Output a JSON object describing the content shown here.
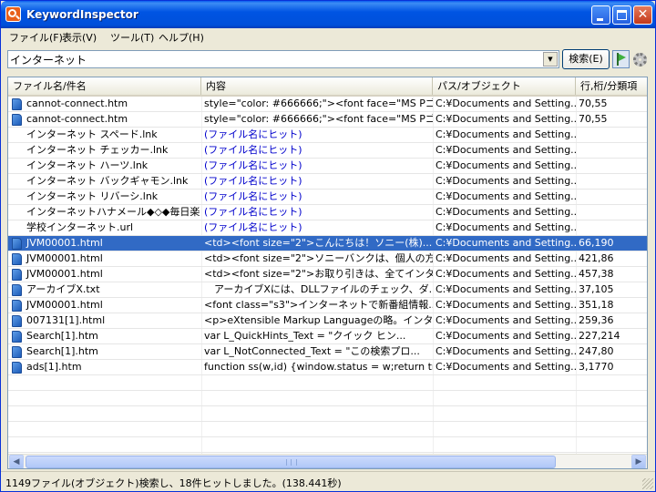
{
  "window": {
    "title": "KeywordInspector"
  },
  "menu": {
    "items": [
      {
        "label": "ファイル(F)"
      },
      {
        "label": "表示(V)"
      },
      {
        "label": "ツール(T)"
      },
      {
        "label": "ヘルプ(H)"
      }
    ]
  },
  "search": {
    "query": "インターネット",
    "button_label": "検索(E)"
  },
  "table": {
    "columns": [
      {
        "label": "ファイル名/件名"
      },
      {
        "label": "内容"
      },
      {
        "label": "パス/オブジェクト"
      },
      {
        "label": "行,桁/分類項"
      }
    ],
    "rows": [
      {
        "icon": "html-file-icon",
        "name": "cannot-connect.htm",
        "content": "style=\"color: #666666;\"><font face=\"MS Pゴシ...",
        "path": "C:¥Documents and Setting...",
        "pos": "70,55",
        "content_link": false
      },
      {
        "icon": "html-file-icon",
        "name": "cannot-connect.htm",
        "content": "style=\"color: #666666;\"><font face=\"MS Pゴシ...",
        "path": "C:¥Documents and Setting...",
        "pos": "70,55",
        "content_link": false
      },
      {
        "icon": "",
        "name": "インターネット スペード.lnk",
        "content": "(ファイル名にヒット)",
        "path": "C:¥Documents and Setting...",
        "pos": "",
        "content_link": true
      },
      {
        "icon": "",
        "name": "インターネット チェッカー.lnk",
        "content": "(ファイル名にヒット)",
        "path": "C:¥Documents and Setting...",
        "pos": "",
        "content_link": true
      },
      {
        "icon": "",
        "name": "インターネット ハーツ.lnk",
        "content": "(ファイル名にヒット)",
        "path": "C:¥Documents and Setting...",
        "pos": "",
        "content_link": true
      },
      {
        "icon": "",
        "name": "インターネット バックギャモン.lnk",
        "content": "(ファイル名にヒット)",
        "path": "C:¥Documents and Setting...",
        "pos": "",
        "content_link": true
      },
      {
        "icon": "",
        "name": "インターネット リバーシ.lnk",
        "content": "(ファイル名にヒット)",
        "path": "C:¥Documents and Setting...",
        "pos": "",
        "content_link": true
      },
      {
        "icon": "",
        "name": "インターネットハナメール◆◇◆毎日楽",
        "content": "(ファイル名にヒット)",
        "path": "C:¥Documents and Setting...",
        "pos": "",
        "content_link": true
      },
      {
        "icon": "",
        "name": "学校インターネット.url",
        "content": "(ファイル名にヒット)",
        "path": "C:¥Documents and Setting...",
        "pos": "",
        "content_link": true
      },
      {
        "icon": "html-file-icon",
        "name": "JVM00001.html",
        "content": "<td><font size=\"2\">こんにちは！ソニー(株)...",
        "path": "C:¥Documents and Setting...",
        "pos": "66,190",
        "content_link": false,
        "selected": true
      },
      {
        "icon": "html-file-icon",
        "name": "JVM00001.html",
        "content": "<td><font size=\"2\">ソニーバンクは、個人の方...",
        "path": "C:¥Documents and Setting...",
        "pos": "421,86",
        "content_link": false
      },
      {
        "icon": "html-file-icon",
        "name": "JVM00001.html",
        "content": "<td><font size=\"2\">お取り引きは、全てインター...",
        "path": "C:¥Documents and Setting...",
        "pos": "457,38",
        "content_link": false
      },
      {
        "icon": "text-file-icon",
        "name": "アーカイブX.txt",
        "content": "　アーカイブXには、DLLファイルのチェック、ダ...",
        "path": "C:¥Documents and Setting...",
        "pos": "37,105",
        "content_link": false
      },
      {
        "icon": "html-file-icon",
        "name": "JVM00001.html",
        "content": "<font class=\"s3\">インターネットで新番組情報...",
        "path": "C:¥Documents and Setting...",
        "pos": "351,18",
        "content_link": false
      },
      {
        "icon": "html-file-icon",
        "name": "007131[1].html",
        "content": "<p>eXtensible Markup Languageの略。インター...",
        "path": "C:¥Documents and Setting...",
        "pos": "259,36",
        "content_link": false
      },
      {
        "icon": "html-file-icon",
        "name": "Search[1].htm",
        "content": "var L_QuickHints_Text          = \"クイック ヒン...",
        "path": "C:¥Documents and Setting...",
        "pos": "227,214",
        "content_link": false
      },
      {
        "icon": "html-file-icon",
        "name": "Search[1].htm",
        "content": "var L_NotConnected_Text        = \"この検索プロ...",
        "path": "C:¥Documents and Setting...",
        "pos": "247,80",
        "content_link": false
      },
      {
        "icon": "html-file-icon",
        "name": "ads[1].htm",
        "content": "function ss(w,id) {window.status = w;return tru...",
        "path": "C:¥Documents and Setting...",
        "pos": "3,1770",
        "content_link": false
      }
    ]
  },
  "status": {
    "text": "1149ファイル(オブジェクト)検索し、18件ヒットしました。(138.441秒)"
  },
  "colors": {
    "selection": "#316AC5",
    "link": "#0000CC",
    "titlebar": "#0054E3"
  }
}
